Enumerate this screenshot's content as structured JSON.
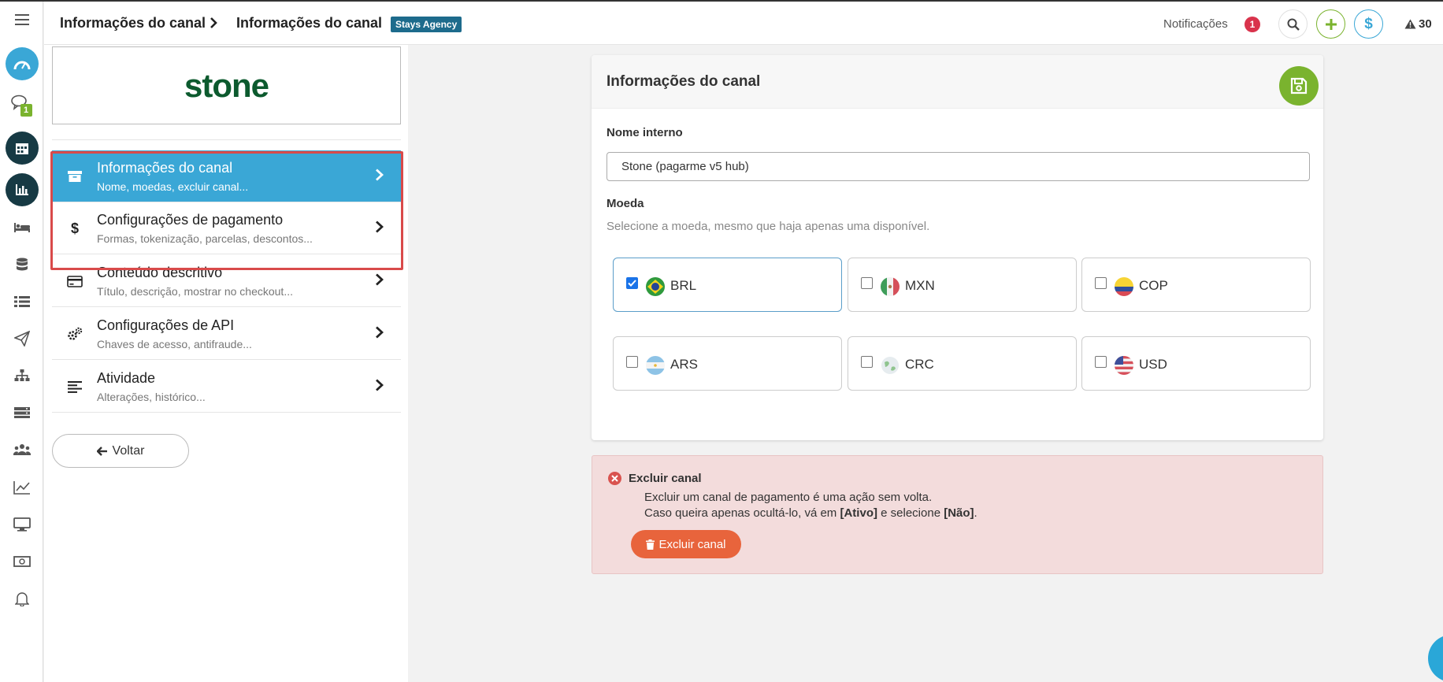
{
  "header": {
    "breadcrumb_1": "Informações do canal",
    "breadcrumb_2": "Informações do canal",
    "agency_badge": "Stays Agency",
    "notifications_label": "Notificações",
    "notifications_count": "1",
    "warnings_count": "30"
  },
  "rail": {
    "chat_badge": "1",
    "icons": [
      "dashboard-icon",
      "chat-icon",
      "calendar-icon",
      "reports-icon",
      "bed-icon",
      "database-icon",
      "list-icon",
      "send-icon",
      "sitemap-icon",
      "server-icon",
      "users-icon",
      "chart-line-icon",
      "monitor-icon",
      "money-icon",
      "bell-icon"
    ]
  },
  "side": {
    "logo_text": "stone",
    "menu": [
      {
        "title": "Informações do canal",
        "subtitle": "Nome, moedas, excluir canal...",
        "icon": "archive-icon",
        "active": true
      },
      {
        "title": "Configurações de pagamento",
        "subtitle": "Formas, tokenização, parcelas, descontos...",
        "icon": "dollar-icon",
        "active": false
      },
      {
        "title": "Conteúdo descritivo",
        "subtitle": "Título, descrição, mostrar no checkout...",
        "icon": "credit-card-icon",
        "active": false
      },
      {
        "title": "Configurações de API",
        "subtitle": "Chaves de acesso, antifraude...",
        "icon": "gears-icon",
        "active": false
      },
      {
        "title": "Atividade",
        "subtitle": "Alterações, histórico...",
        "icon": "align-left-icon",
        "active": false
      }
    ],
    "back_label": "Voltar"
  },
  "card": {
    "title": "Informações do canal",
    "internal_name_label": "Nome interno",
    "internal_name_value": "Stone (pagarme v5 hub)",
    "currency_label": "Moeda",
    "currency_hint": "Selecione a moeda, mesmo que haja apenas uma disponível.",
    "currencies": [
      {
        "code": "BRL",
        "checked": true
      },
      {
        "code": "MXN",
        "checked": false
      },
      {
        "code": "COP",
        "checked": false
      },
      {
        "code": "ARS",
        "checked": false
      },
      {
        "code": "CRC",
        "checked": false
      },
      {
        "code": "USD",
        "checked": false
      }
    ]
  },
  "danger": {
    "title": "Excluir canal",
    "line1": "Excluir um canal de pagamento é uma ação sem volta.",
    "line2_prefix": "Caso queira apenas ocultá-lo, vá em ",
    "line2_ativo": "[Ativo]",
    "line2_middle": " e selecione ",
    "line2_nao": "[Não]",
    "line2_suffix": ".",
    "button_label": "Excluir canal"
  },
  "colors": {
    "active_menu": "#3aa7d6",
    "save_button": "#7ab32e",
    "danger_button": "#e8643c",
    "danger_bg": "#f3dcdc",
    "badge_blue": "#1d6b8c",
    "highlight_red": "#d94a4a"
  }
}
